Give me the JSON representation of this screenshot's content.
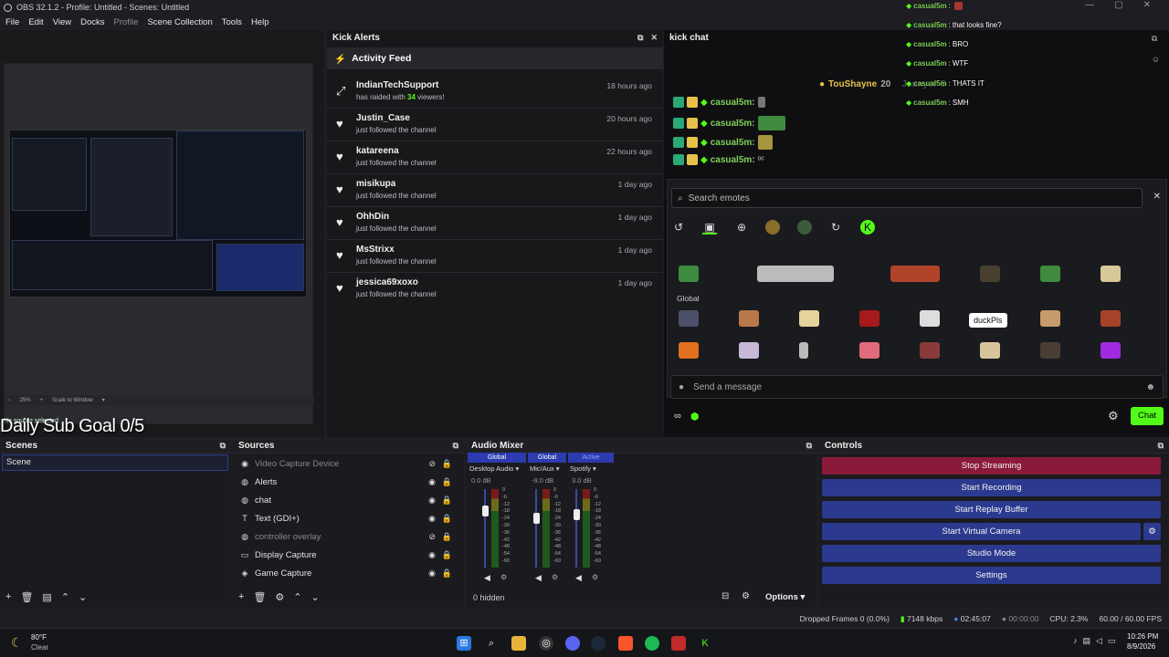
{
  "window": {
    "title": "OBS 32.1.2 - Profile: Untitled - Scenes: Untitled"
  },
  "menu": [
    "File",
    "Edit",
    "View",
    "Docks",
    "Profile",
    "Scene Collection",
    "Tools",
    "Help"
  ],
  "preview": {
    "zoom": "25%",
    "fit": "Scale to Window",
    "overlay_text": "Daily Sub Goal 0/5",
    "no_source": "No source selected"
  },
  "alerts": {
    "title": "Kick Alerts",
    "feed_title": "Activity Feed",
    "items": [
      {
        "name": "IndianTechSupport",
        "sub_pre": "has raided with ",
        "count": "34",
        "sub_post": " viewers!",
        "time": "18 hours ago",
        "icon": "raid-icon"
      },
      {
        "name": "Justin_Case",
        "sub": "just followed the channel",
        "time": "20 hours ago",
        "icon": "heart-icon"
      },
      {
        "name": "katareena",
        "sub": "just followed the channel",
        "time": "22 hours ago",
        "icon": "heart-icon"
      },
      {
        "name": "misikupa",
        "sub": "just followed the channel",
        "time": "1 day ago",
        "icon": "heart-icon"
      },
      {
        "name": "OhhDin",
        "sub": "just followed the channel",
        "time": "1 day ago",
        "icon": "heart-icon"
      },
      {
        "name": "MsStrixx",
        "sub": "just followed the channel",
        "time": "1 day ago",
        "icon": "heart-icon"
      },
      {
        "name": "jessica69xoxo",
        "sub": "just followed the channel",
        "time": "1 day ago",
        "icon": "heart-icon"
      }
    ]
  },
  "chat": {
    "title": "kick chat",
    "leader": {
      "name": "TouShayne",
      "count": "20",
      "name2": "Jaunyer",
      "count2": "5"
    },
    "messages": [
      {
        "user": "casual5m:"
      },
      {
        "user": "casual5m:"
      },
      {
        "user": "casual5m:"
      },
      {
        "user": "casual5m:"
      }
    ],
    "overlay_messages": [
      {
        "user": "casual5m",
        "text": ""
      },
      {
        "user": "casual5m",
        "text": "that looks fine?"
      },
      {
        "user": "casual5m",
        "text": "BRO"
      },
      {
        "user": "casual5m",
        "text": "WTF"
      },
      {
        "user": "casual5m",
        "text": "THATS IT"
      },
      {
        "user": "casual5m",
        "text": "SMH"
      }
    ],
    "search_placeholder": "Search emotes",
    "global_label": "Global",
    "tooltip": "duckPls",
    "send_placeholder": "Send a message",
    "chat_button": "Chat"
  },
  "scenes": {
    "title": "Scenes",
    "items": [
      "Scene"
    ]
  },
  "sources": {
    "title": "Sources",
    "items": [
      {
        "name": "Video Capture Device",
        "visible": false,
        "icon": "camera-icon"
      },
      {
        "name": "Alerts",
        "visible": true,
        "icon": "browser-icon"
      },
      {
        "name": "chat",
        "visible": true,
        "icon": "browser-icon"
      },
      {
        "name": "Text (GDI+)",
        "visible": true,
        "icon": "text-icon"
      },
      {
        "name": "controller overlay",
        "visible": false,
        "icon": "browser-icon"
      },
      {
        "name": "Display Capture",
        "visible": true,
        "icon": "monitor-icon"
      },
      {
        "name": "Game Capture",
        "visible": true,
        "icon": "gamepad-icon"
      }
    ]
  },
  "mixer": {
    "title": "Audio Mixer",
    "hidden": "0 hidden",
    "options": "Options",
    "channels": [
      {
        "tag": "Global",
        "name": "Desktop Audio",
        "db": "0.0 dB",
        "level": 0.55
      },
      {
        "tag": "Global",
        "name": "Mic/Aux",
        "db": "-9.0 dB",
        "level": 0.35
      },
      {
        "tag": "Active",
        "name": "Spotify",
        "db": "3.0 dB",
        "level": 0.45
      }
    ],
    "scale": [
      "0",
      "-6",
      "-12",
      "-18",
      "-24",
      "-30",
      "-36",
      "-42",
      "-48",
      "-54",
      "-60"
    ]
  },
  "controls": {
    "title": "Controls",
    "buttons": [
      "Stop Streaming",
      "Start Recording",
      "Start Replay Buffer",
      "Start Virtual Camera",
      "Studio Mode",
      "Settings"
    ]
  },
  "status": {
    "dropped": "Dropped Frames 0 (0.0%)",
    "kbps": "7148 kbps",
    "live": "02:45:07",
    "rec": "00:00:00",
    "cpu": "CPU: 2.3%",
    "fps": "60.00 / 60.00 FPS"
  },
  "taskbar": {
    "weather_temp": "80°F",
    "weather_desc": "Clear",
    "time": "10:26 PM",
    "date": "8/9/2026"
  },
  "colors": {
    "kick_green": "#53fc18",
    "stop_stream": "#8a1a3a",
    "control_blue": "#2b3a8f"
  }
}
